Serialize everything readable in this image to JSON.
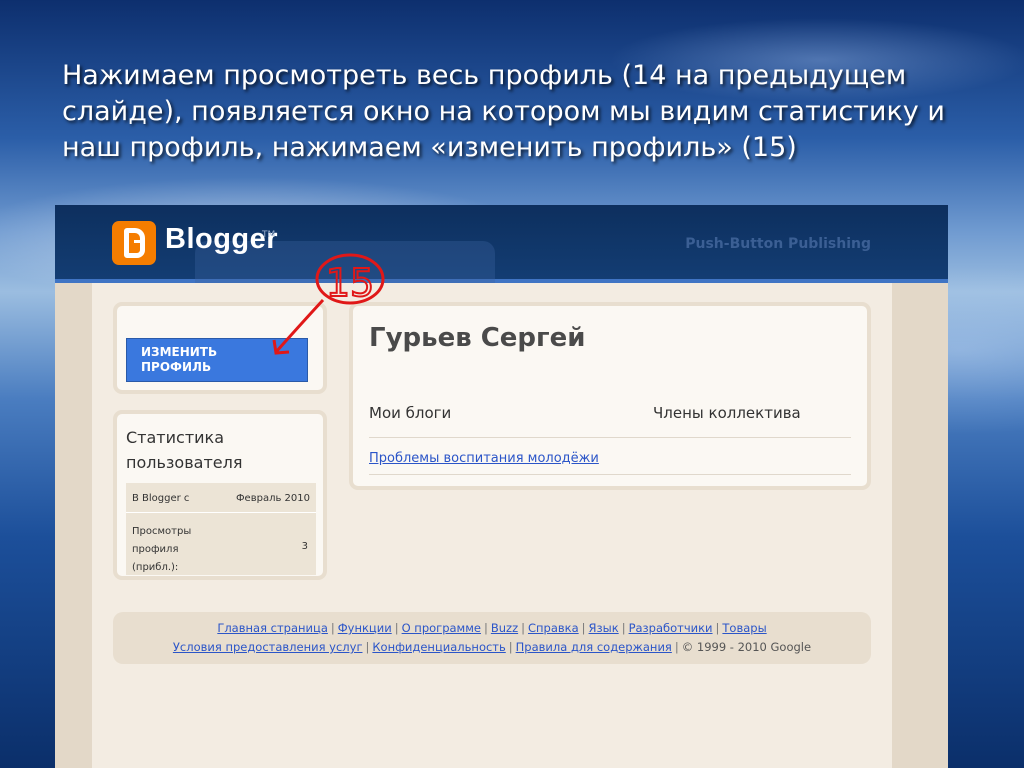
{
  "slide": {
    "text": "Нажимаем просмотреть весь профиль (14 на предыдущем слайде), появляется окно на котором мы видим статистику и наш профиль, нажимаем «изменить профиль» (15)"
  },
  "header": {
    "logo_text": "Blogger",
    "logo_tm": "TM",
    "tagline": "Push-Button Publishing"
  },
  "sidebar": {
    "edit_line1": "ИЗМЕНИТЬ",
    "edit_line2": "ПРОФИЛЬ",
    "stats_title_line1": "Статистика",
    "stats_title_line2": "пользователя",
    "stats": {
      "since_label": "В Blogger с",
      "since_value": "Февраль 2010",
      "views_label_line1": "Просмотры",
      "views_label_line2": "профиля",
      "views_label_line3": "(прибл.):",
      "views_value": "3"
    }
  },
  "profile": {
    "name": "Гурьев Сергей",
    "col_blogs": "Мои блоги",
    "col_members": "Члены коллектива",
    "blog_link": "Проблемы воспитания молодёжи"
  },
  "footer": {
    "row1": [
      "Главная страница",
      "Функции",
      "О программе",
      "Buzz",
      "Справка",
      "Язык",
      "Разработчики",
      "Товары"
    ],
    "row2": [
      "Условия предоставления услуг",
      "Конфиденциальность",
      "Правила для содержания"
    ],
    "copyright": "© 1999 - 2010 Google",
    "separator": "|"
  },
  "annotation": {
    "label": "15",
    "color": "#e01818"
  }
}
